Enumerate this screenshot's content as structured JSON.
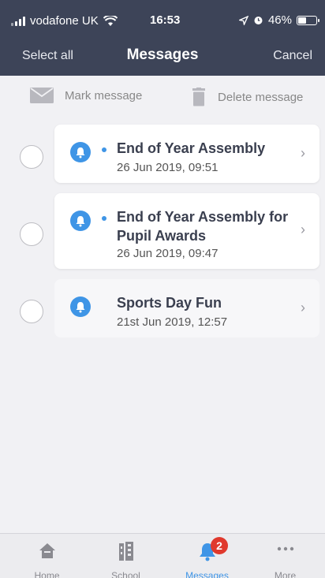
{
  "status_bar": {
    "carrier": "vodafone UK",
    "time": "16:53",
    "battery": "46%",
    "battery_level": 0.46
  },
  "nav": {
    "left": "Select all",
    "title": "Messages",
    "right": "Cancel"
  },
  "toolbar": {
    "mark_label": "Mark message",
    "delete_label": "Delete message"
  },
  "messages": [
    {
      "title": "End of Year Assembly",
      "date": "26 Jun 2019, 09:51",
      "unread": true
    },
    {
      "title": "End of Year Assembly for Pupil Awards",
      "date": "26 Jun 2019, 09:47",
      "unread": true
    },
    {
      "title": "Sports Day Fun",
      "date": "21st Jun 2019, 12:57",
      "unread": false
    }
  ],
  "tabs": [
    {
      "label": "Home",
      "icon": "home-icon"
    },
    {
      "label": "School",
      "icon": "school-icon"
    },
    {
      "label": "Messages",
      "icon": "bell-icon",
      "badge": "2",
      "active": true
    },
    {
      "label": "More",
      "icon": "more-icon"
    }
  ],
  "colors": {
    "header": "#3d4458",
    "accent": "#3f95e6",
    "badge": "#e0392d"
  }
}
